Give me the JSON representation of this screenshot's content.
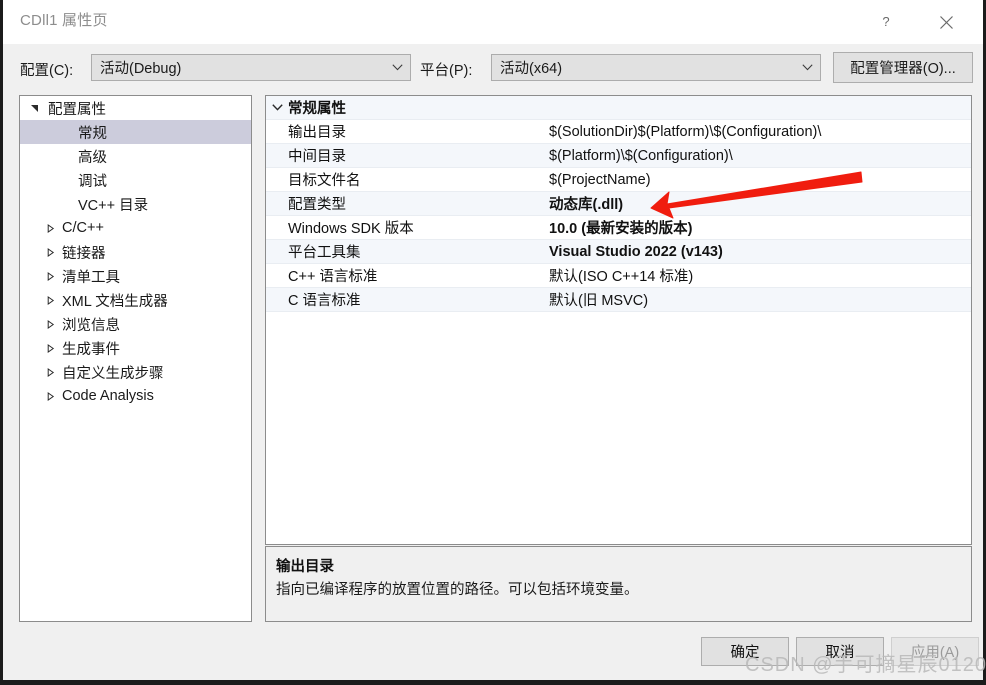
{
  "window": {
    "title": "CDll1 属性页",
    "help_icon": "question-mark-icon",
    "close_icon": "close-icon"
  },
  "toolbar": {
    "config_label": "配置(C):",
    "config_value": "活动(Debug)",
    "platform_label": "平台(P):",
    "platform_value": "活动(x64)",
    "config_manager_label": "配置管理器(O)..."
  },
  "tree": {
    "items": [
      {
        "label": "配置属性",
        "level": "root",
        "twisty": "expanded",
        "selected": false
      },
      {
        "label": "常规",
        "level": "child",
        "twisty": "none",
        "selected": true
      },
      {
        "label": "高级",
        "level": "child",
        "twisty": "none",
        "selected": false
      },
      {
        "label": "调试",
        "level": "child",
        "twisty": "none",
        "selected": false
      },
      {
        "label": "VC++ 目录",
        "level": "child",
        "twisty": "none",
        "selected": false
      },
      {
        "label": "C/C++",
        "level": "group",
        "twisty": "collapsed",
        "selected": false
      },
      {
        "label": "链接器",
        "level": "group",
        "twisty": "collapsed",
        "selected": false
      },
      {
        "label": "清单工具",
        "level": "group",
        "twisty": "collapsed",
        "selected": false
      },
      {
        "label": "XML 文档生成器",
        "level": "group",
        "twisty": "collapsed",
        "selected": false
      },
      {
        "label": "浏览信息",
        "level": "group",
        "twisty": "collapsed",
        "selected": false
      },
      {
        "label": "生成事件",
        "level": "group",
        "twisty": "collapsed",
        "selected": false
      },
      {
        "label": "自定义生成步骤",
        "level": "group",
        "twisty": "collapsed",
        "selected": false
      },
      {
        "label": "Code Analysis",
        "level": "group",
        "twisty": "collapsed",
        "selected": false
      }
    ]
  },
  "grid": {
    "category": "常规属性",
    "category_twisty": "chevron-down-icon",
    "rows": [
      {
        "label": "输出目录",
        "value": "$(SolutionDir)$(Platform)\\$(Configuration)\\",
        "bold": false
      },
      {
        "label": "中间目录",
        "value": "$(Platform)\\$(Configuration)\\",
        "bold": false
      },
      {
        "label": "目标文件名",
        "value": "$(ProjectName)",
        "bold": false
      },
      {
        "label": "配置类型",
        "value": "动态库(.dll)",
        "bold": true
      },
      {
        "label": "Windows SDK 版本",
        "value": "10.0 (最新安装的版本)",
        "bold": true
      },
      {
        "label": "平台工具集",
        "value": "Visual Studio 2022 (v143)",
        "bold": true
      },
      {
        "label": "C++ 语言标准",
        "value": "默认(ISO C++14 标准)",
        "bold": false
      },
      {
        "label": "C 语言标准",
        "value": "默认(旧 MSVC)",
        "bold": false
      }
    ]
  },
  "description": {
    "title": "输出目录",
    "body": "指向已编译程序的放置位置的路径。可以包括环境变量。"
  },
  "buttons": {
    "ok": "确定",
    "cancel": "取消",
    "apply": "应用(A)"
  },
  "annotation": {
    "arrow_color": "#f01d0f",
    "arrow_target": "配置类型"
  },
  "watermark": {
    "text": "CSDN @手可摘星辰0120"
  }
}
